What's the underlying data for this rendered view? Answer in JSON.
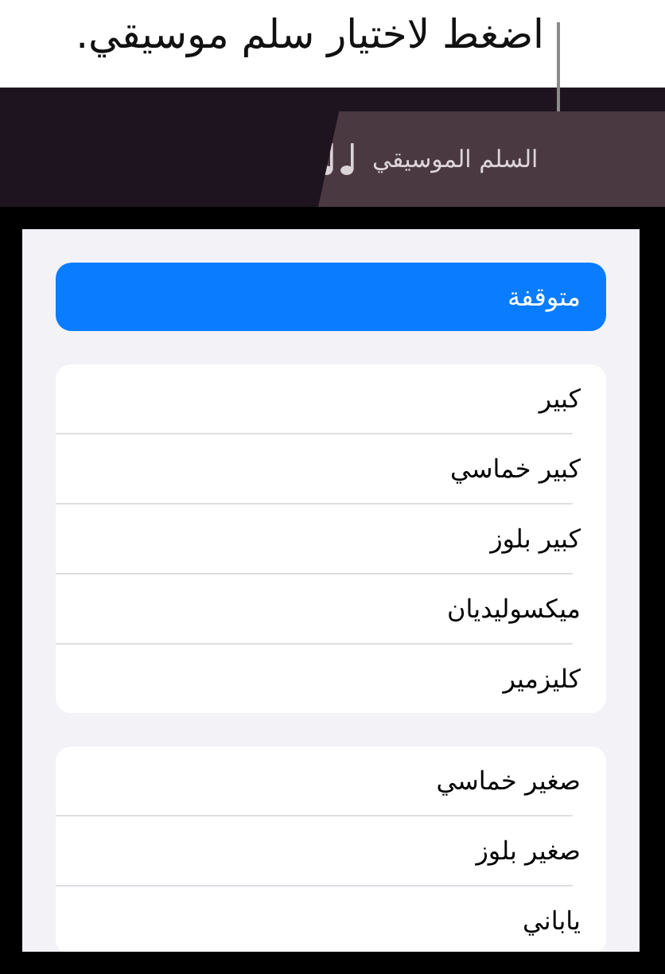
{
  "callout": {
    "text": "اضغط لاختيار سلم موسيقي."
  },
  "tab": {
    "label": "السلم الموسيقي"
  },
  "scale_groups": [
    [
      {
        "label": "متوقفة",
        "selected": true
      }
    ],
    [
      {
        "label": "كبير",
        "selected": false
      },
      {
        "label": "كبير خماسي",
        "selected": false
      },
      {
        "label": "كبير بلوز",
        "selected": false
      },
      {
        "label": "ميكسوليديان",
        "selected": false
      },
      {
        "label": "كليزمير",
        "selected": false
      }
    ],
    [
      {
        "label": "صغير خماسي",
        "selected": false
      },
      {
        "label": "صغير بلوز",
        "selected": false
      },
      {
        "label": "ياباني",
        "selected": false
      }
    ]
  ]
}
